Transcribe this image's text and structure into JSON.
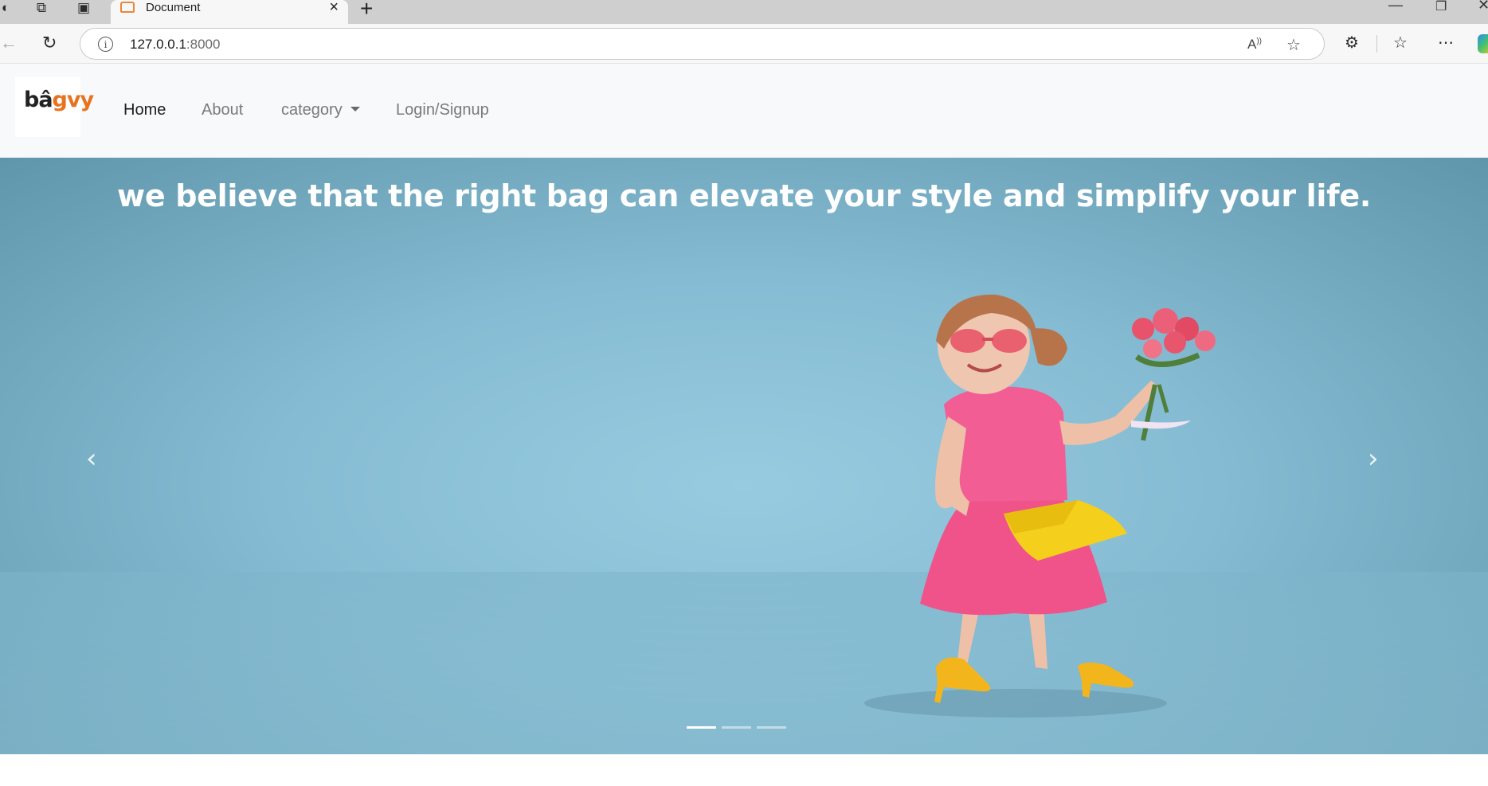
{
  "browser": {
    "tab_title": "Document",
    "url_host": "127.0.0.1",
    "url_port": ":8000"
  },
  "navbar": {
    "logo": {
      "prefix": "bâ",
      "suffix": "gvy"
    },
    "links": [
      "Home",
      "About",
      "category",
      "Login/Signup"
    ],
    "active_link": "Home"
  },
  "hero": {
    "caption": "we believe that the right bag can elevate your style and simplify your life.",
    "slides_count": 3,
    "active_slide": 1
  },
  "colors": {
    "navbar_bg": "#f8f9fa",
    "hero_bg": "#86bcd3",
    "logo_accent": "#e8731e",
    "dress": "#f0538a",
    "bag": "#f4cf1c"
  },
  "icons": {
    "prev": "chevron-left-icon",
    "next": "chevron-right-icon"
  }
}
